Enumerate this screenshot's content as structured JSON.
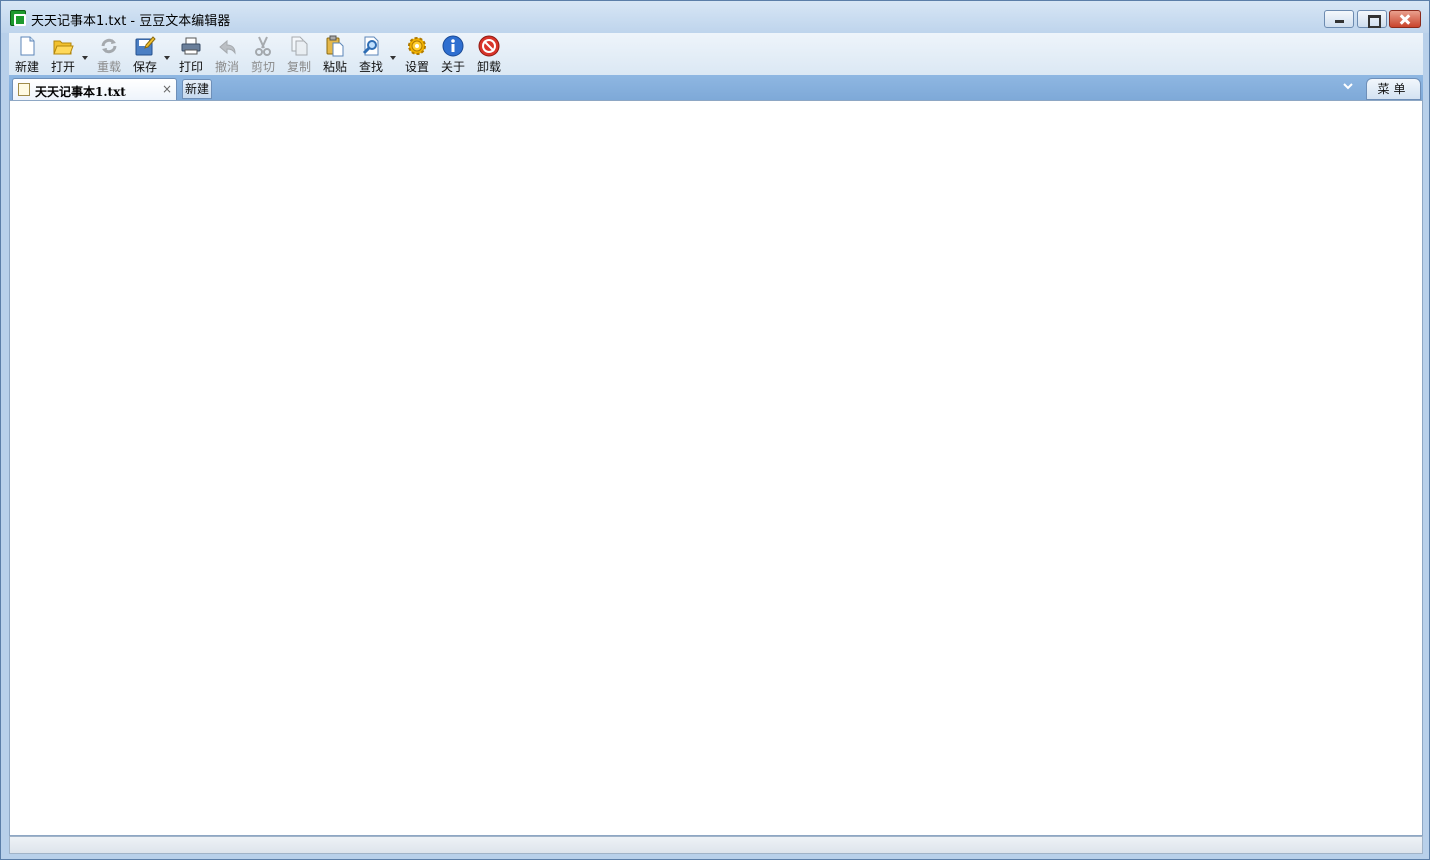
{
  "window": {
    "title": "天天记事本1.txt - 豆豆文本编辑器"
  },
  "toolbar": {
    "items": [
      {
        "label": "新建",
        "icon": "new-file-icon",
        "enabled": true
      },
      {
        "label": "打开",
        "icon": "open-folder-icon",
        "enabled": true,
        "dropdown": true
      },
      {
        "label": "重载",
        "icon": "reload-icon",
        "enabled": false
      },
      {
        "label": "保存",
        "icon": "save-icon",
        "enabled": true,
        "dropdown": true
      },
      {
        "label": "打印",
        "icon": "print-icon",
        "enabled": true
      },
      {
        "label": "撤消",
        "icon": "undo-icon",
        "enabled": false
      },
      {
        "label": "剪切",
        "icon": "cut-icon",
        "enabled": false
      },
      {
        "label": "复制",
        "icon": "copy-icon",
        "enabled": false
      },
      {
        "label": "粘贴",
        "icon": "paste-icon",
        "enabled": true
      },
      {
        "label": "查找",
        "icon": "find-icon",
        "enabled": true,
        "dropdown": true
      },
      {
        "label": "设置",
        "icon": "settings-gear-icon",
        "enabled": true
      },
      {
        "label": "关于",
        "icon": "about-info-icon",
        "enabled": true
      },
      {
        "label": "卸载",
        "icon": "uninstall-icon",
        "enabled": true
      }
    ]
  },
  "tabs": {
    "active_label": "天天记事本1.txt",
    "close_glyph": "×",
    "new_label": "新建",
    "menu_label": "菜单"
  },
  "editor": {
    "content": ""
  },
  "colors": {
    "tabbar": "#86b0dc",
    "accent_close": "#c9442c"
  }
}
